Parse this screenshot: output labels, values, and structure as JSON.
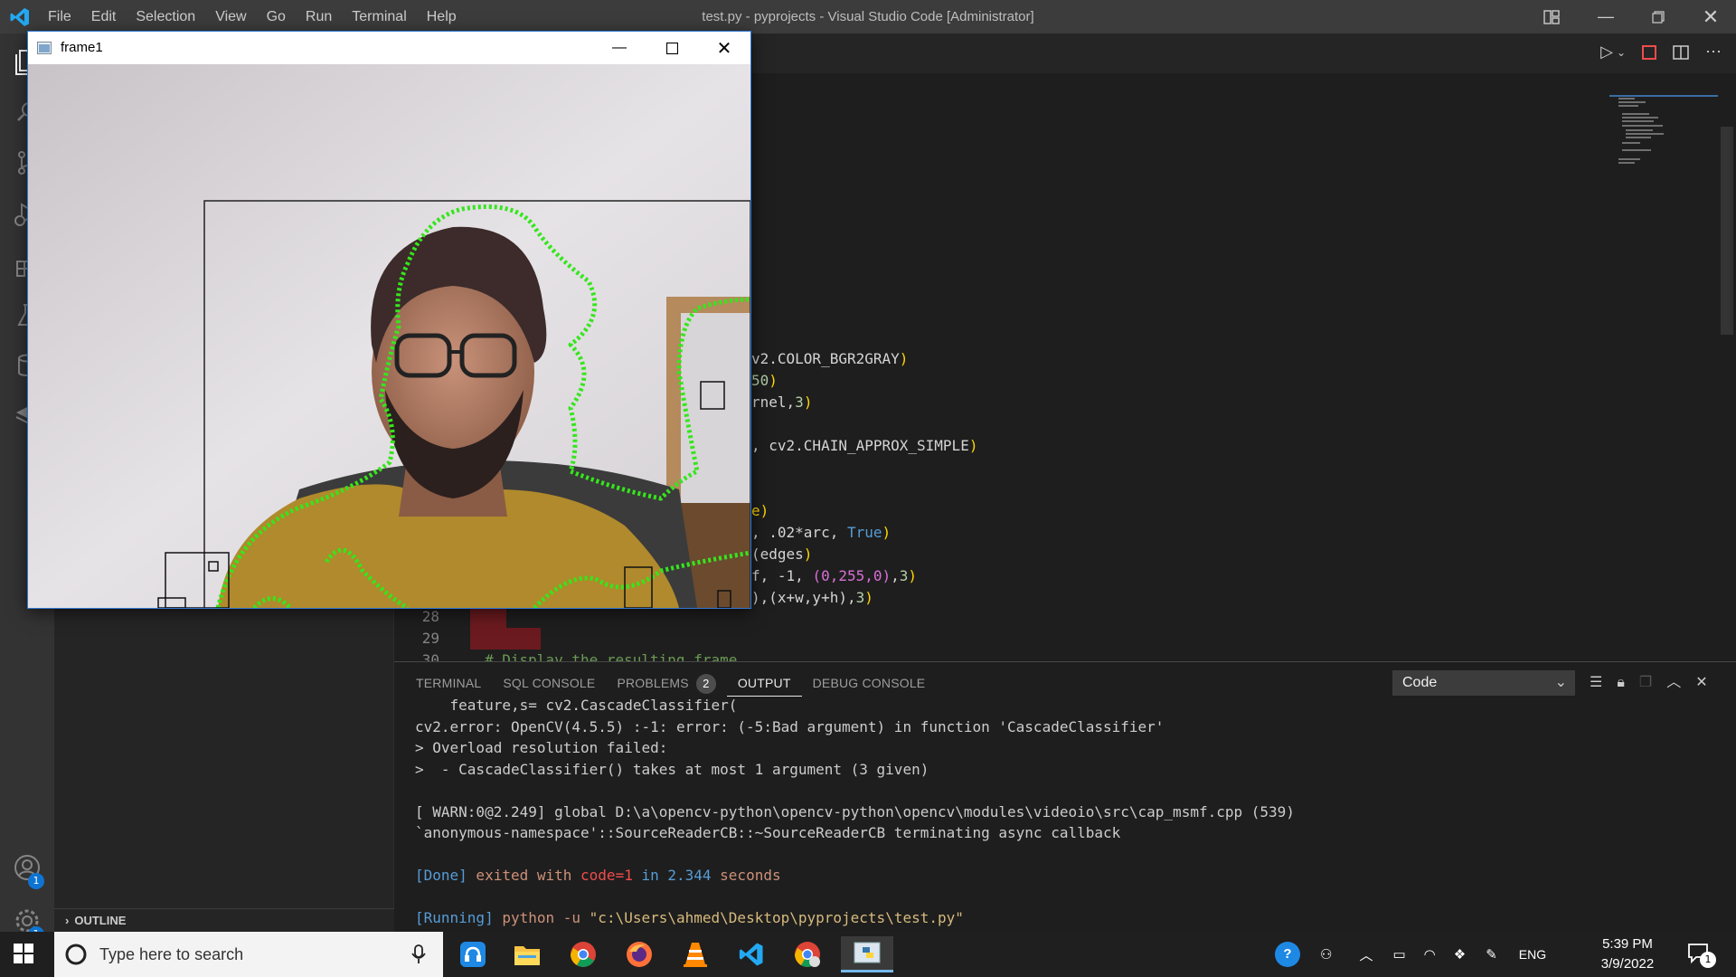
{
  "titlebar": {
    "menu": [
      "File",
      "Edit",
      "Selection",
      "View",
      "Go",
      "Run",
      "Terminal",
      "Help"
    ],
    "title": "test.py - pyprojects - Visual Studio Code [Administrator]"
  },
  "activitybar": {
    "accounts_badge": "1",
    "manage_badge": "1"
  },
  "sidebar": {
    "outline_label": "OUTLINE"
  },
  "editor": {
    "code_fragments": [
      {
        "text_before": "v2.COLOR_BGR2GRAY",
        "paren": ")"
      },
      {
        "num": "50",
        "paren": ")"
      },
      {
        "text_before": "rnel,",
        "num": "3",
        "paren": ")"
      },
      {
        "text_before": ", cv2.CHAIN_APPROX_SIMPLE",
        "paren": ")"
      },
      {
        "paren": "e)"
      },
      {
        "text_before": ", .02*arc, ",
        "kw": "True",
        "paren": ")"
      },
      {
        "text_before": "(edges",
        "paren": ")"
      },
      {
        "text_before": "f, -1, ",
        "tuple": "(0,255,0)",
        "num": "3",
        "paren": ")"
      },
      {
        "text_before": "),(x+w,y+h),",
        "num": "3",
        "paren": ")"
      }
    ],
    "line_28": "28",
    "line_29": "29",
    "line_30": "30",
    "line_30_comment": "# Display the resulting frame"
  },
  "panel": {
    "tabs": [
      "TERMINAL",
      "SQL CONSOLE",
      "PROBLEMS",
      "OUTPUT",
      "DEBUG CONSOLE"
    ],
    "problems_count": "2",
    "active_tab": "OUTPUT",
    "output_channel": "Code",
    "output_lines": [
      "    feature,s= cv2.CascadeClassifier(",
      "cv2.error: OpenCV(4.5.5) :-1: error: (-5:Bad argument) in function 'CascadeClassifier'",
      "> Overload resolution failed:",
      ">  - CascadeClassifier() takes at most 1 argument (3 given)",
      "",
      "[ WARN:0@2.249] global D:\\a\\opencv-python\\opencv-python\\opencv\\modules\\videoio\\src\\cap_msmf.cpp (539)",
      "`anonymous-namespace'::SourceReaderCB::~SourceReaderCB terminating async callback",
      ""
    ],
    "done_line": {
      "tag": "[Done]",
      "text1": " exited with ",
      "code": "code=1",
      "text2": " in ",
      "time": "2.344",
      "text3": " seconds"
    },
    "running_line": {
      "tag": "[Running]",
      "cmd": " python -u ",
      "path": "\"c:\\Users\\ahmed\\Desktop\\pyprojects\\test.py\""
    }
  },
  "frame1": {
    "title": "frame1"
  },
  "taskbar": {
    "search_placeholder": "Type here to search",
    "language": "ENG",
    "time": "5:39 PM",
    "date": "3/9/2022",
    "notification_badge": "1"
  },
  "colors": {
    "titlebar": "#3c3c3c",
    "activitybar": "#333333",
    "sidebar": "#252526",
    "editor": "#1e1e1e",
    "accent": "#0e74d2",
    "contour_green": "#35e61c"
  }
}
